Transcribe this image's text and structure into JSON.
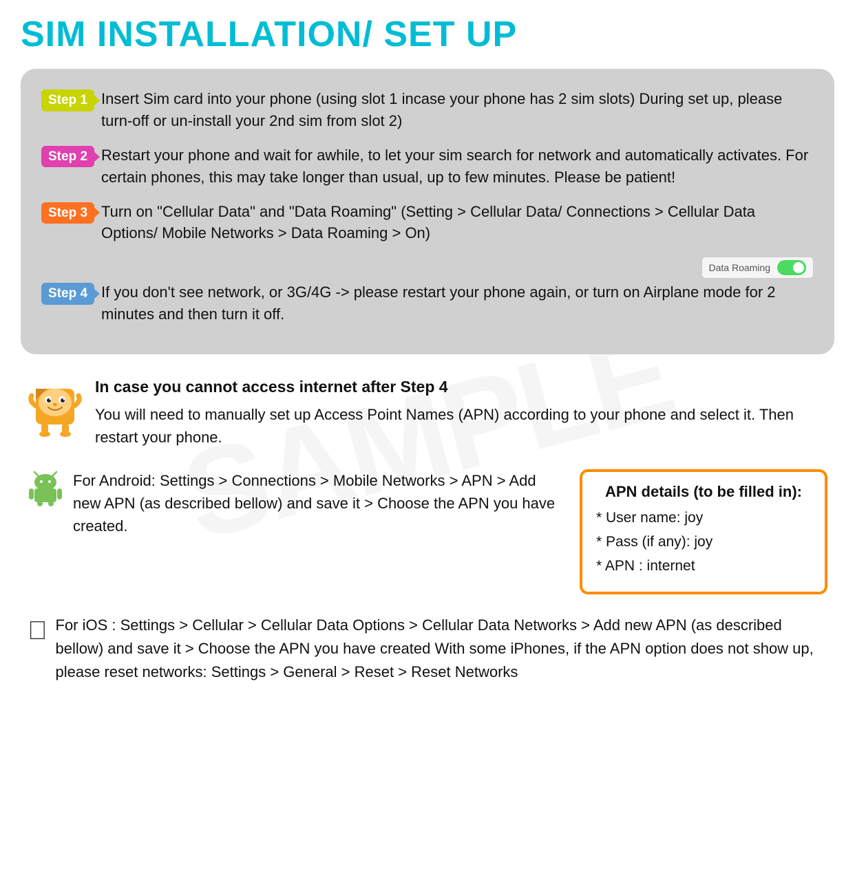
{
  "page": {
    "title": "SIM INSTALLATION/ SET UP",
    "watermark": "SAMPLE"
  },
  "steps": [
    {
      "badge": "Step 1",
      "badge_class": "step1-badge",
      "text": "Insert Sim card into your phone (using slot 1 incase your phone has 2 sim slots) During set up, please turn-off or un-install your 2nd sim from slot 2)"
    },
    {
      "badge": "Step 2",
      "badge_class": "step2-badge",
      "text": "Restart your phone and wait for awhile, to let your sim search for network and  automatically  activates.  For  certain  phones,  this  may  take  longer  than usual, up to few minutes. Please be patient!"
    },
    {
      "badge": "Step 3",
      "badge_class": "step3-badge",
      "text": "Turn  on  \"Cellular  Data\"  and  \"Data  Roaming\"  (Setting  >  Cellular  Data/ Connections > Cellular Data Options/ Mobile Networks > Data Roaming > On)"
    },
    {
      "badge": "Step 4",
      "badge_class": "step4-badge",
      "text": "If you don't see network, or 3G/4G -> please restart your phone again, or turn on Airplane mode for 2 minutes and then turn it off."
    }
  ],
  "toggle": {
    "label": "Data Roaming"
  },
  "cannot_access": {
    "bold_title": "In case you cannot access internet after Step 4",
    "body": "You will need to manually set up Access Point Names (APN) according to your phone  and select it. Then restart your phone."
  },
  "android": {
    "text": "For Android: Settings > Connections > Mobile Networks >  APN > Add new APN  (as described bellow) and save it  > Choose the APN you have created."
  },
  "apn_details": {
    "title": "APN details (to be filled in):",
    "items": [
      "* User name: joy",
      "* Pass (if any): joy",
      "* APN : internet"
    ]
  },
  "ios": {
    "text": "For iOS : Settings > Cellular > Cellular Data Options > Cellular Data Networks > Add new APN  (as described bellow) and save it  > Choose the APN you have created With some iPhones, if the APN option does not show up, please reset networks: Settings > General >  Reset > Reset Networks"
  }
}
